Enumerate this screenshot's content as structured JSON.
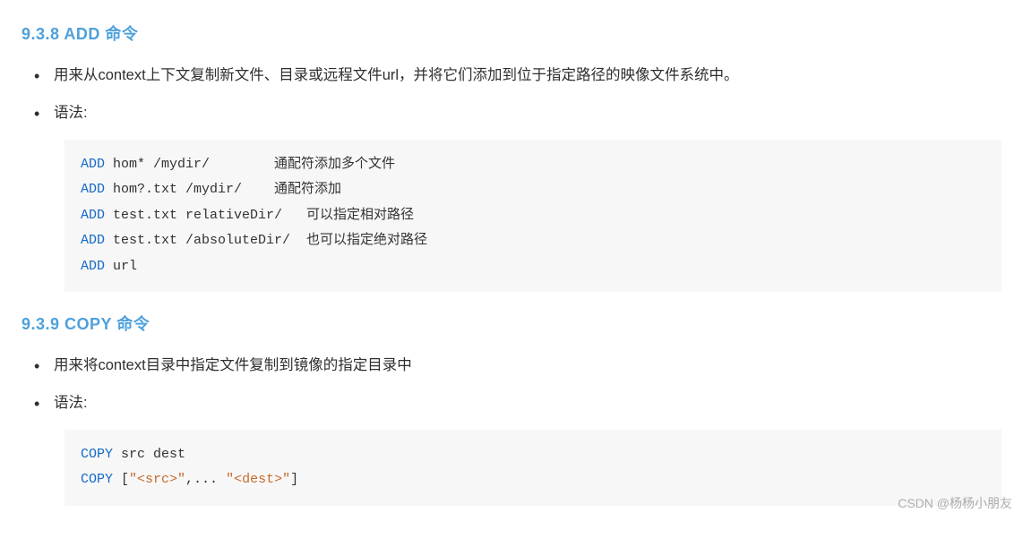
{
  "sections": [
    {
      "heading": "9.3.8 ADD 命令",
      "bullets": [
        "用来从context上下文复制新文件、目录或远程文件url，并将它们添加到位于指定路径的映像文件系统中。",
        "语法:"
      ],
      "code_lines": [
        {
          "kw": "ADD",
          "rest": " hom* /mydir/        通配符添加多个文件"
        },
        {
          "kw": "ADD",
          "rest": " hom?.txt /mydir/    通配符添加"
        },
        {
          "kw": "ADD",
          "rest": " test.txt relativeDir/   可以指定相对路径"
        },
        {
          "kw": "ADD",
          "rest": " test.txt /absoluteDir/  也可以指定绝对路径"
        },
        {
          "kw": "ADD",
          "rest": " url"
        }
      ]
    },
    {
      "heading": "9.3.9 COPY 命令",
      "bullets": [
        "用来将context目录中指定文件复制到镜像的指定目录中",
        "语法:"
      ],
      "code_lines": [
        {
          "kw": "COPY",
          "rest": " src dest"
        },
        {
          "kw": "COPY",
          "rest_parts": [
            {
              "t": "txt",
              "v": " ["
            },
            {
              "t": "str",
              "v": "\"<src>\""
            },
            {
              "t": "txt",
              "v": ",... "
            },
            {
              "t": "str",
              "v": "\"<dest>\""
            },
            {
              "t": "txt",
              "v": "]"
            }
          ]
        }
      ]
    }
  ],
  "watermark": "CSDN @杨杨小朋友"
}
